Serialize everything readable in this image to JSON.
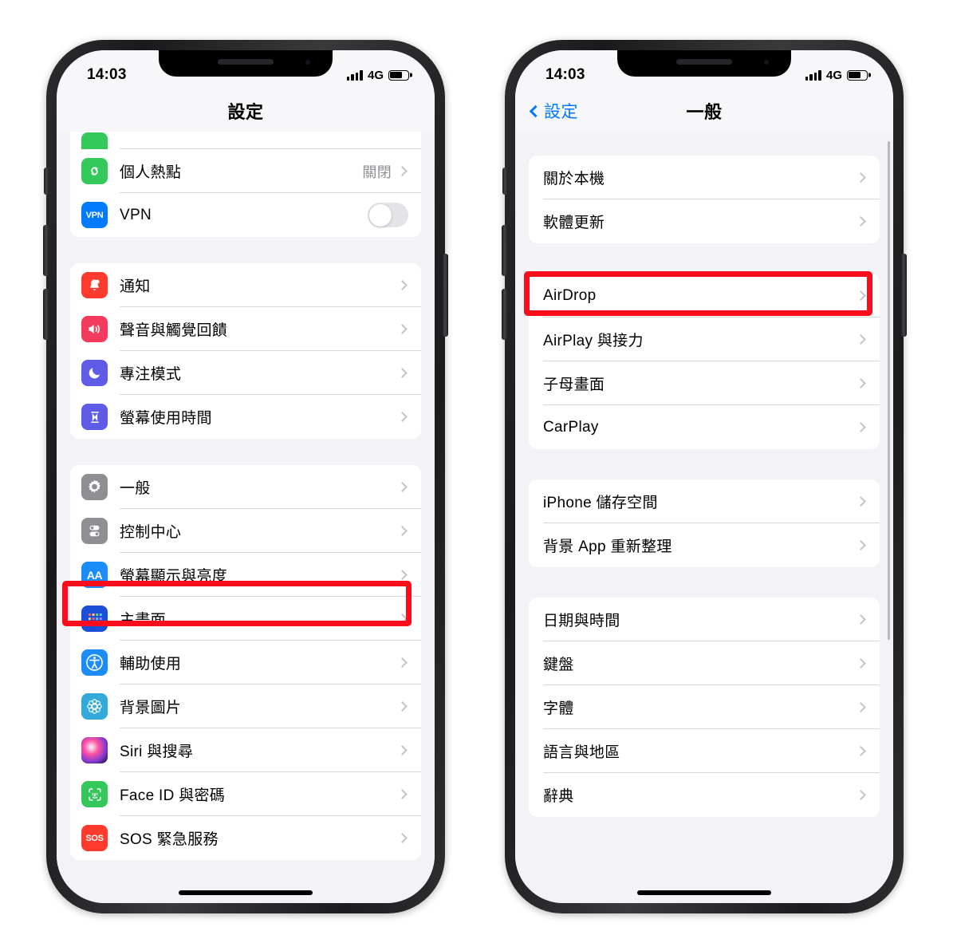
{
  "status_bar": {
    "time": "14:03",
    "network": "4G",
    "signal_icon": "cellular-signal-icon",
    "battery_icon": "battery-icon"
  },
  "colors": {
    "highlight": "#fc0d1b",
    "accent_blue": "#007aff",
    "screen_background": "#f2f2f7",
    "group_background": "#ffffff",
    "secondary_text": "#8e8e93"
  },
  "phone_left": {
    "nav": {
      "title": "設定"
    },
    "groups": [
      {
        "rows": [
          {
            "label": "",
            "icon": "cut-green-icon",
            "cut": true,
            "accessory": "none"
          },
          {
            "label": "個人熱點",
            "icon": "personal-hotspot-icon",
            "value": "關閉",
            "accessory": "chevron"
          },
          {
            "label": "VPN",
            "icon": "vpn-icon",
            "icon_text": "VPN",
            "accessory": "toggle",
            "toggle_on": false
          }
        ]
      },
      {
        "rows": [
          {
            "label": "通知",
            "icon": "notifications-icon",
            "accessory": "chevron"
          },
          {
            "label": "聲音與觸覺回饋",
            "icon": "sounds-haptics-icon",
            "accessory": "chevron"
          },
          {
            "label": "專注模式",
            "icon": "focus-icon",
            "accessory": "chevron"
          },
          {
            "label": "螢幕使用時間",
            "icon": "screen-time-icon",
            "accessory": "chevron"
          }
        ]
      },
      {
        "rows": [
          {
            "label": "一般",
            "icon": "general-gear-icon",
            "accessory": "chevron",
            "highlighted": true
          },
          {
            "label": "控制中心",
            "icon": "control-center-icon",
            "accessory": "chevron"
          },
          {
            "label": "螢幕顯示與亮度",
            "icon": "display-brightness-icon",
            "icon_text": "AA",
            "accessory": "chevron"
          },
          {
            "label": "主畫面",
            "icon": "home-screen-icon",
            "accessory": "chevron"
          },
          {
            "label": "輔助使用",
            "icon": "accessibility-icon",
            "accessory": "chevron"
          },
          {
            "label": "背景圖片",
            "icon": "wallpaper-icon",
            "accessory": "chevron"
          },
          {
            "label": "Siri 與搜尋",
            "icon": "siri-search-icon",
            "accessory": "chevron"
          },
          {
            "label": "Face ID 與密碼",
            "icon": "face-id-icon",
            "accessory": "chevron"
          },
          {
            "label": "SOS 緊急服務",
            "icon": "emergency-sos-icon",
            "icon_text": "SOS",
            "accessory": "chevron"
          }
        ]
      }
    ]
  },
  "phone_right": {
    "nav": {
      "back_label": "設定",
      "title": "一般"
    },
    "groups": [
      {
        "rows": [
          {
            "label": "關於本機",
            "accessory": "chevron"
          },
          {
            "label": "軟體更新",
            "accessory": "chevron",
            "highlighted": true
          }
        ]
      },
      {
        "rows": [
          {
            "label": "AirDrop",
            "accessory": "chevron"
          },
          {
            "label": "AirPlay 與接力",
            "accessory": "chevron"
          },
          {
            "label": "子母畫面",
            "accessory": "chevron"
          },
          {
            "label": "CarPlay",
            "accessory": "chevron"
          }
        ]
      },
      {
        "rows": [
          {
            "label": "iPhone 儲存空間",
            "accessory": "chevron"
          },
          {
            "label": "背景 App 重新整理",
            "accessory": "chevron"
          }
        ]
      },
      {
        "rows": [
          {
            "label": "日期與時間",
            "accessory": "chevron"
          },
          {
            "label": "鍵盤",
            "accessory": "chevron"
          },
          {
            "label": "字體",
            "accessory": "chevron"
          },
          {
            "label": "語言與地區",
            "accessory": "chevron"
          },
          {
            "label": "辭典",
            "accessory": "chevron"
          }
        ]
      }
    ]
  }
}
